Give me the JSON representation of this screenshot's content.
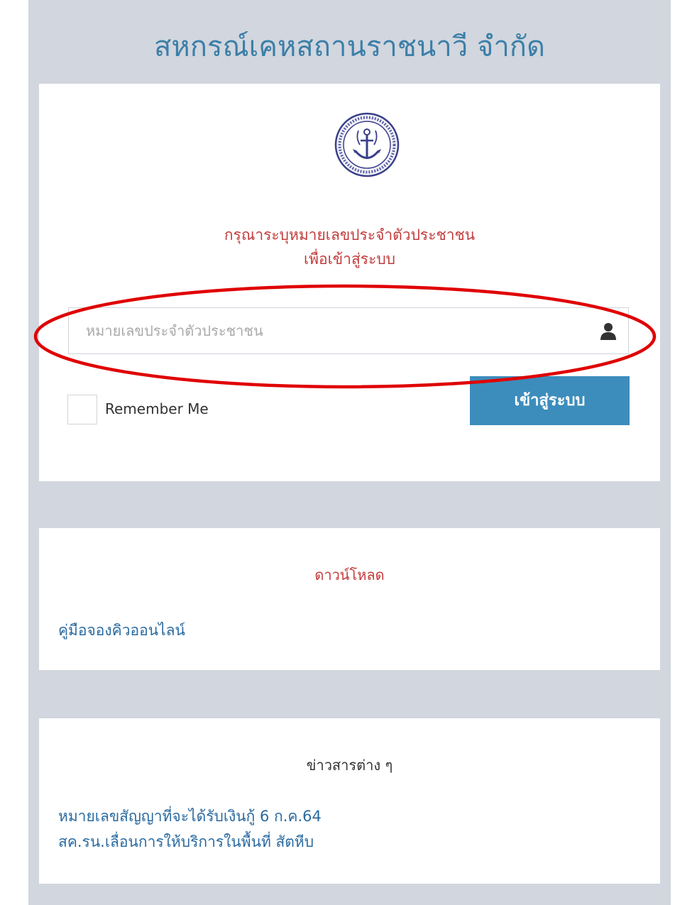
{
  "header": {
    "title": "สหกรณ์เคหสถานราชนาวี จำกัด"
  },
  "login": {
    "prompt_line1": "กรุณาระบุหมายเลขประจำตัวประชาชน",
    "prompt_line2": "เพื่อเข้าสู่ระบบ",
    "id_placeholder": "หมายเลขประจำตัวประชาชน",
    "id_value": "",
    "remember_label": "Remember Me",
    "remember_checked": false,
    "submit_label": "เข้าสู่ระบบ"
  },
  "download": {
    "title": "ดาวน์โหลด",
    "links": [
      "คู่มือจองคิวออนไลน์"
    ]
  },
  "news": {
    "title": "ข่าวสารต่าง ๆ",
    "links": [
      "หมายเลขสัญญาที่จะได้รับเงินกู้ 6 ก.ค.64",
      "สค.รน.เลื่อนการให้บริการในพื้นที่ สัตหีบ"
    ]
  },
  "colors": {
    "accent": "#3c8dbc",
    "title_blue": "#3c7fa8",
    "prompt_red": "#c23b3b",
    "annotation_red": "#e00000",
    "page_bg": "#d2d6de"
  },
  "icons": [
    "user-icon",
    "anchor-seal-logo"
  ]
}
